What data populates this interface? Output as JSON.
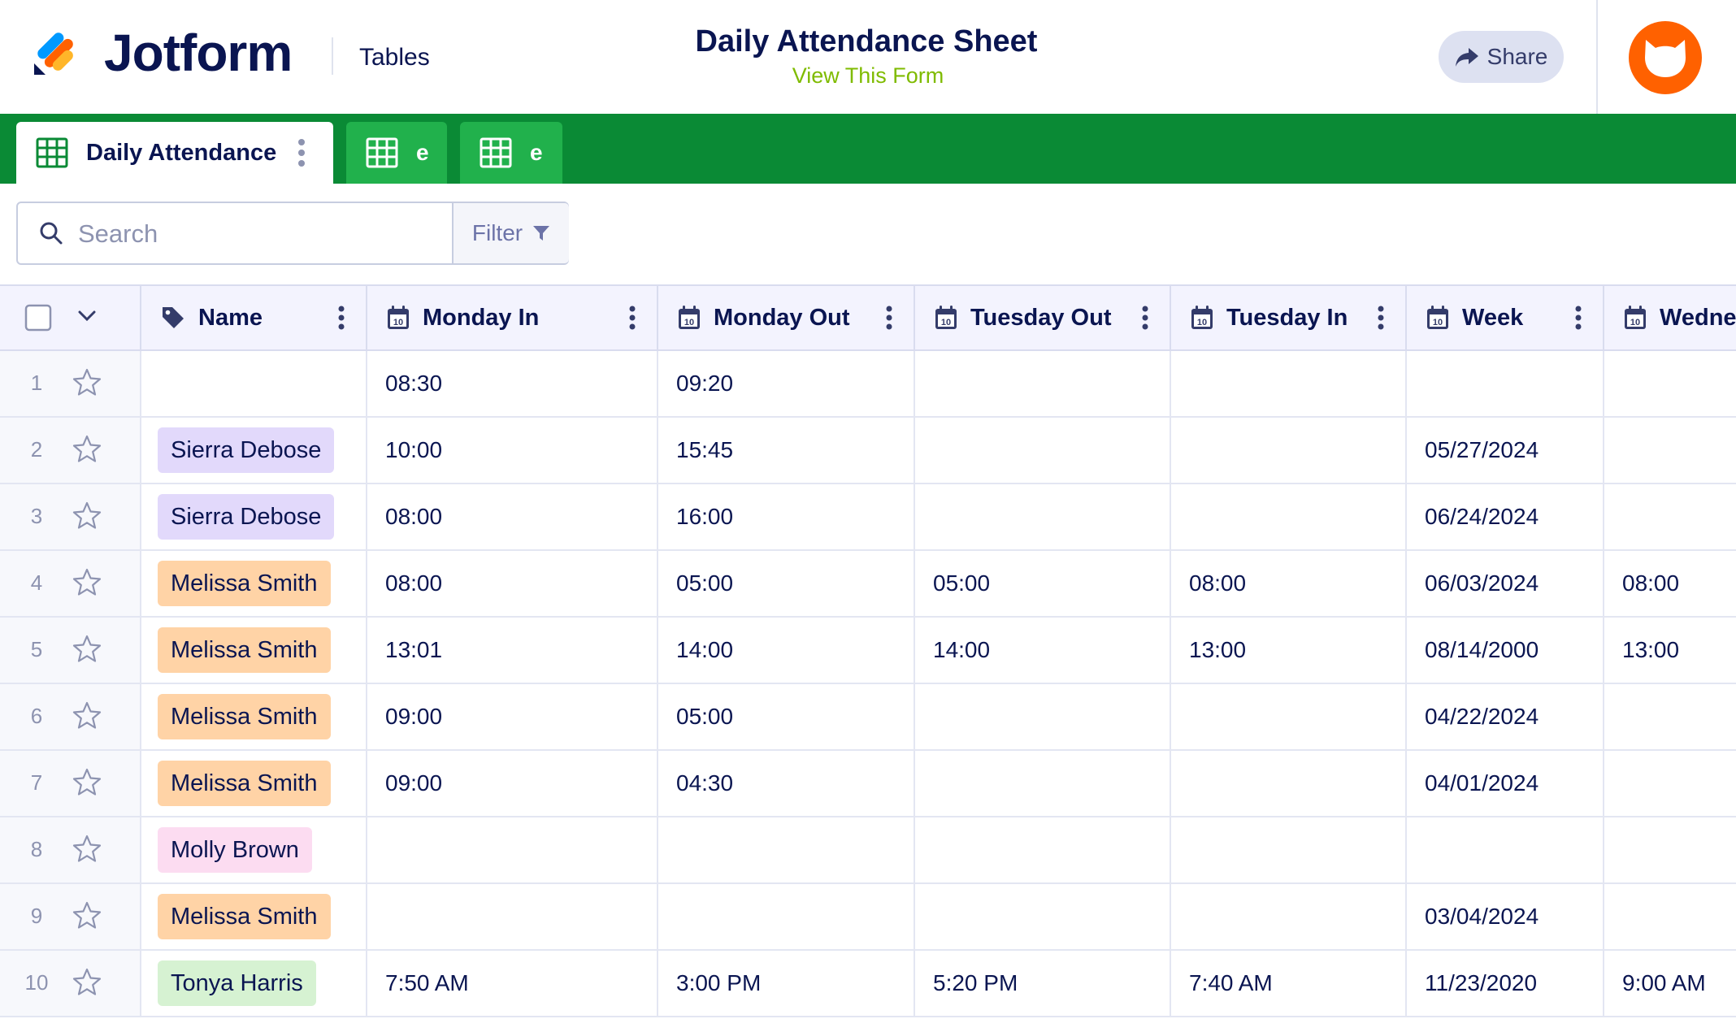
{
  "header": {
    "brand": "Jotform",
    "section": "Tables",
    "title": "Daily Attendance Sheet",
    "view_link": "View This Form",
    "share_label": "Share"
  },
  "tabs": [
    {
      "label": "Daily Attendance",
      "active": true
    },
    {
      "label": "e",
      "active": false
    },
    {
      "label": "e",
      "active": false
    }
  ],
  "toolbar": {
    "search_placeholder": "Search",
    "filter_label": "Filter"
  },
  "table": {
    "columns": [
      "Name",
      "Monday In",
      "Monday Out",
      "Tuesday Out",
      "Tuesday In",
      "Week",
      "Wedne"
    ],
    "rows": [
      {
        "num": "1",
        "name": "",
        "tag": "",
        "cells": [
          "08:30",
          "09:20",
          "",
          "",
          "",
          ""
        ]
      },
      {
        "num": "2",
        "name": "Sierra Debose",
        "tag": "lav",
        "cells": [
          "10:00",
          "15:45",
          "",
          "",
          "05/27/2024",
          ""
        ]
      },
      {
        "num": "3",
        "name": "Sierra Debose",
        "tag": "lav",
        "cells": [
          "08:00",
          "16:00",
          "",
          "",
          "06/24/2024",
          ""
        ]
      },
      {
        "num": "4",
        "name": "Melissa Smith",
        "tag": "peach",
        "cells": [
          "08:00",
          "05:00",
          "05:00",
          "08:00",
          "06/03/2024",
          "08:00"
        ]
      },
      {
        "num": "5",
        "name": "Melissa Smith",
        "tag": "peach",
        "cells": [
          "13:01",
          "14:00",
          "14:00",
          "13:00",
          "08/14/2000",
          "13:00"
        ]
      },
      {
        "num": "6",
        "name": "Melissa Smith",
        "tag": "peach",
        "cells": [
          "09:00",
          "05:00",
          "",
          "",
          "04/22/2024",
          ""
        ]
      },
      {
        "num": "7",
        "name": "Melissa Smith",
        "tag": "peach",
        "cells": [
          "09:00",
          "04:30",
          "",
          "",
          "04/01/2024",
          ""
        ]
      },
      {
        "num": "8",
        "name": "Molly Brown",
        "tag": "pink",
        "cells": [
          "",
          "",
          "",
          "",
          "",
          ""
        ]
      },
      {
        "num": "9",
        "name": "Melissa Smith",
        "tag": "peach",
        "cells": [
          "",
          "",
          "",
          "",
          "03/04/2024",
          ""
        ]
      },
      {
        "num": "10",
        "name": "Tonya Harris",
        "tag": "green",
        "cells": [
          "7:50 AM",
          "3:00 PM",
          "5:20 PM",
          "7:40 AM",
          "11/23/2020",
          "9:00 AM"
        ]
      }
    ]
  },
  "colors": {
    "brand_navy": "#0a1551",
    "tab_bar_green": "#0a8a35",
    "tab_inactive_green": "#21b14c",
    "link_green": "#7fbb00",
    "avatar_orange": "#ff6100",
    "tag_lavender": "#e2d9fb",
    "tag_peach": "#ffd3a6",
    "tag_pink": "#fcdcf1",
    "tag_green": "#d6f2d2"
  }
}
